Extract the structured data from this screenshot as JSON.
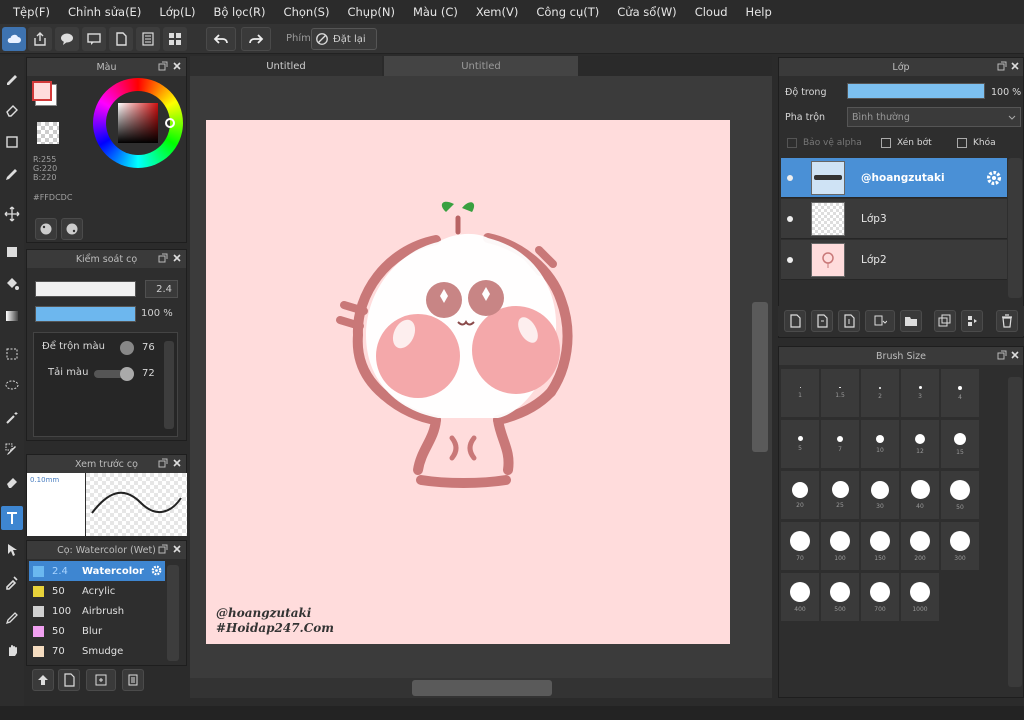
{
  "menu": [
    "Tệp(F)",
    "Chỉnh sửa(E)",
    "Lớp(L)",
    "Bộ lọc(R)",
    "Chọn(S)",
    "Chụp(N)",
    "Màu (C)",
    "Xem(V)",
    "Công cụ(T)",
    "Cửa sổ(W)",
    "Cloud",
    "Help"
  ],
  "toolbar": {
    "key_label": "Phím",
    "reset_label": "Đặt lại"
  },
  "tabs": [
    "Untitled",
    "Untitled"
  ],
  "color_panel": {
    "title": "Màu",
    "r": "R:255",
    "g": "G:220",
    "b": "B:220",
    "hex": "#FFDCDC",
    "primary": "#ffdcdc",
    "secondary": "#ffffff"
  },
  "brush_control": {
    "title": "Kiểm soát cọ",
    "size_value": "2.4",
    "opacity_value": "100 %",
    "opacity_fraction": 1.0,
    "blend_label": "Để trộn màu",
    "blend_value": "76",
    "reload_label": "Tải màu",
    "reload_value": "72"
  },
  "brush_preview": {
    "title": "Xem trước cọ",
    "size": "0.10mm"
  },
  "brush_list": {
    "title": "Cọ: Watercolor (Wet)",
    "items": [
      {
        "size": "2.4",
        "name": "Watercolor",
        "color": "#6ab8f0",
        "selected": true
      },
      {
        "size": "50",
        "name": "Acrylic",
        "color": "#e8d23a",
        "selected": false
      },
      {
        "size": "100",
        "name": "Airbrush",
        "color": "#d0d0d0",
        "selected": false
      },
      {
        "size": "50",
        "name": "Blur",
        "color": "#f0a0f0",
        "selected": false
      },
      {
        "size": "70",
        "name": "Smudge",
        "color": "#f5dcc0",
        "selected": false
      }
    ]
  },
  "canvas": {
    "watermark_line1": "@hoangzutaki",
    "watermark_line2": "#Hoidap247.Com",
    "bg_color": "#ffdcdc"
  },
  "layers": {
    "title": "Lớp",
    "opacity_label": "Độ trong",
    "opacity_value": "100 %",
    "opacity_fraction": 1.0,
    "blend_label": "Pha trộn",
    "blend_value": "Bình thường",
    "protect_alpha": "Bảo vệ alpha",
    "clipping": "Xén bớt",
    "lock": "Khóa",
    "items": [
      {
        "name": "@hoangzutaki",
        "selected": true
      },
      {
        "name": "Lớp3",
        "selected": false
      },
      {
        "name": "Lớp2",
        "selected": false
      }
    ]
  },
  "brush_size": {
    "title": "Brush Size",
    "sizes": [
      "1",
      "1.5",
      "2",
      "3",
      "4",
      "5",
      "7",
      "10",
      "12",
      "15",
      "20",
      "25",
      "30",
      "40",
      "50",
      "70",
      "100",
      "150",
      "200",
      "300",
      "400",
      "500",
      "700",
      "1000"
    ]
  }
}
